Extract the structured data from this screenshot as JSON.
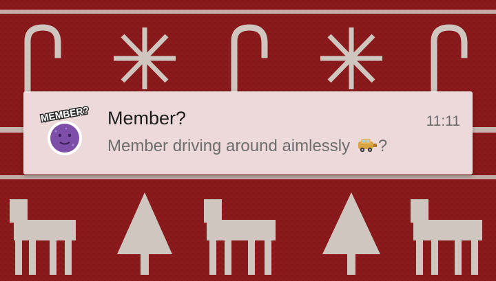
{
  "notification": {
    "app_icon": "member-berry-icon",
    "app_icon_label": "MEMBER?",
    "title": "Member?",
    "time": "11:11",
    "message_text": "Member driving around aimlessly ",
    "message_emoji": "car-emoji-icon",
    "message_suffix": "?"
  },
  "wallpaper": {
    "pattern": "christmas-knit-sweater",
    "colors": {
      "background": "#8b1a1c",
      "knit": "#cfc6c0"
    }
  },
  "colors": {
    "card_background": "#f4e8e8",
    "title": "#1b1b1b",
    "secondary_text": "#6e6e6e",
    "berry": "#7e4fa8"
  }
}
